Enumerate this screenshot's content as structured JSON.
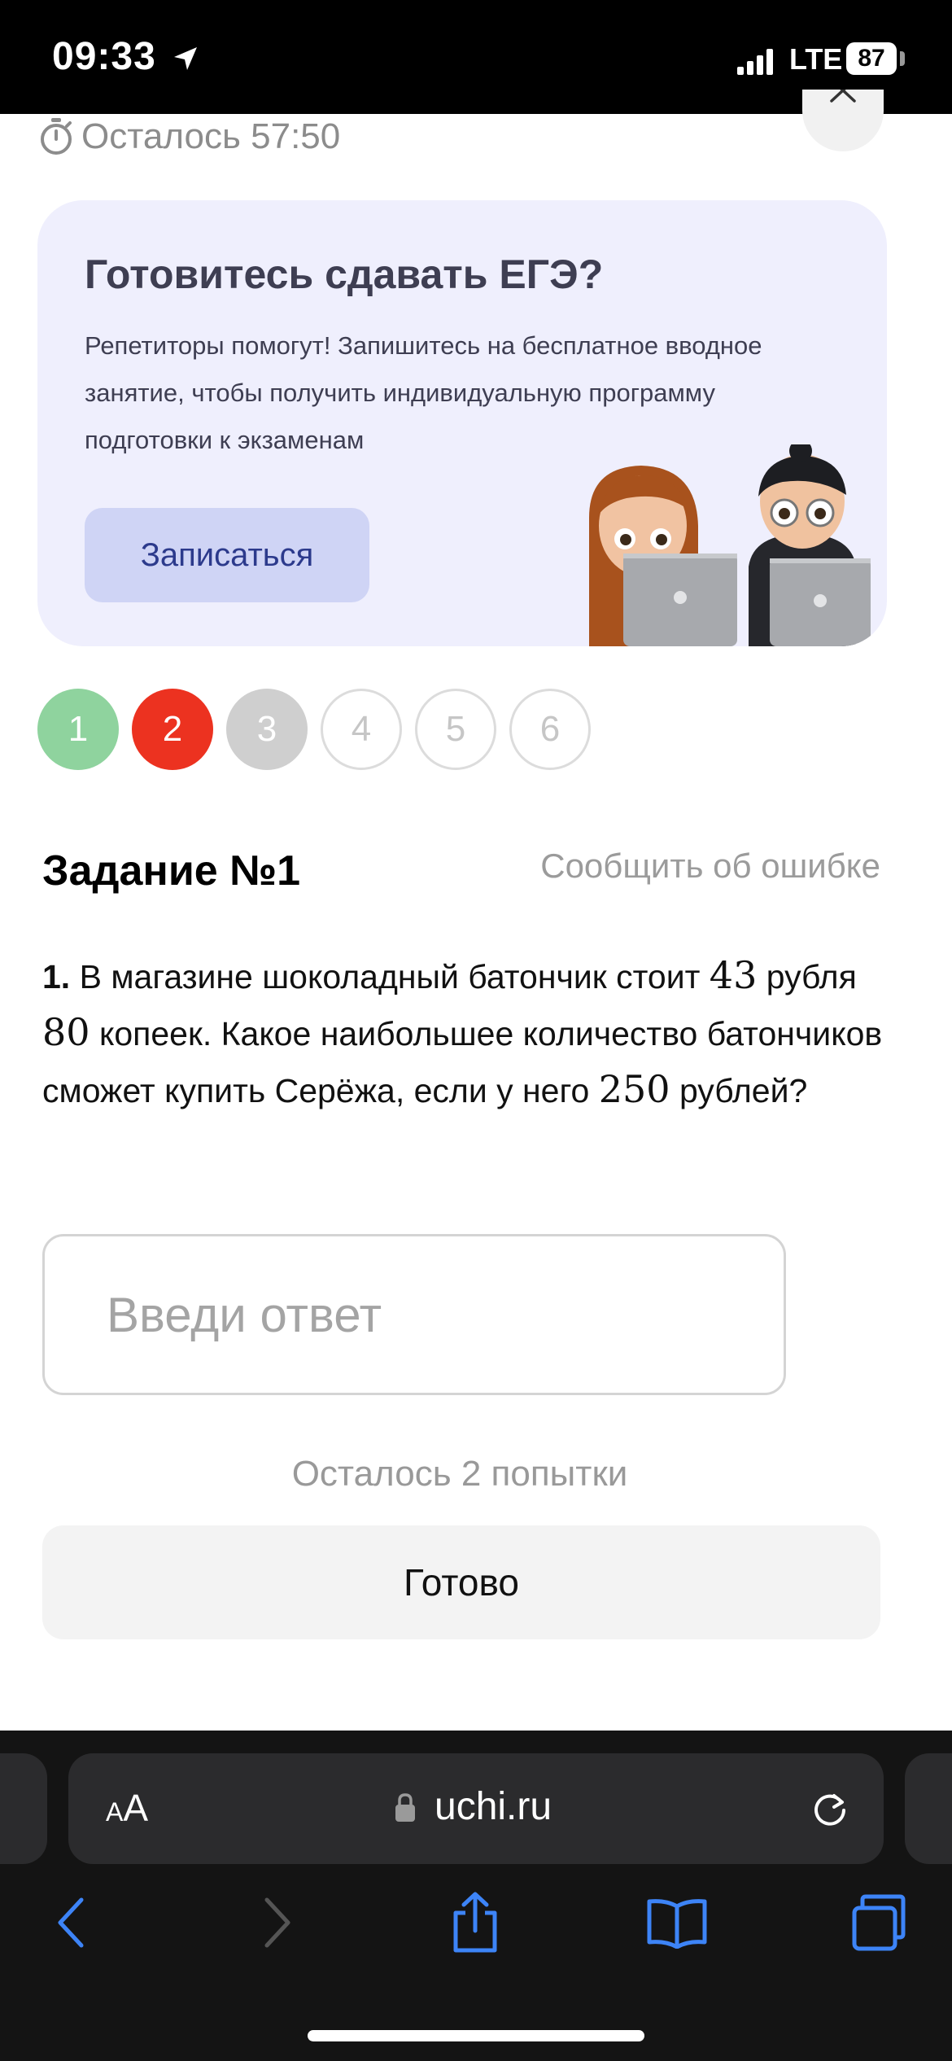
{
  "status_bar": {
    "time": "09:33",
    "network": "LTE",
    "battery": "87"
  },
  "timer": {
    "label": "Осталось 57:50"
  },
  "promo": {
    "title": "Готовитесь сдавать ЕГЭ?",
    "text": "Репетиторы помогут! Запишитесь на бесплатное вводное занятие, чтобы получить индивидуальную программу подготовки к экзаменам",
    "button_label": "Записаться"
  },
  "steps": [
    {
      "label": "1",
      "state": "correct",
      "color": "#8fd39e"
    },
    {
      "label": "2",
      "state": "wrong",
      "color": "#ec3220"
    },
    {
      "label": "3",
      "state": "skipped",
      "color": "#cfcfcf"
    },
    {
      "label": "4",
      "state": "pending"
    },
    {
      "label": "5",
      "state": "pending"
    },
    {
      "label": "6",
      "state": "pending"
    }
  ],
  "task": {
    "title": "Задание №1",
    "report_link": "Сообщить об ошибке",
    "question": {
      "number": "1.",
      "part1": " В магазине шоколадный батончик стоит ",
      "n1": "43",
      "part2": " рубля ",
      "n2": "80",
      "part3": " копеек. Какое наибольшее количество батончиков сможет купить Серёжа, если у него ",
      "n3": "250",
      "part4": " рублей?"
    },
    "answer_placeholder": "Введи ответ",
    "attempts_left": "Осталось 2 попытки",
    "submit_label": "Готово"
  },
  "browser": {
    "text_size_button": "AA",
    "url": "uchi.ru",
    "accent_color": "#3d84f7",
    "icons": [
      "lock-icon",
      "reload-icon",
      "back-icon",
      "forward-icon",
      "share-icon",
      "bookmarks-icon",
      "tabs-icon"
    ]
  }
}
